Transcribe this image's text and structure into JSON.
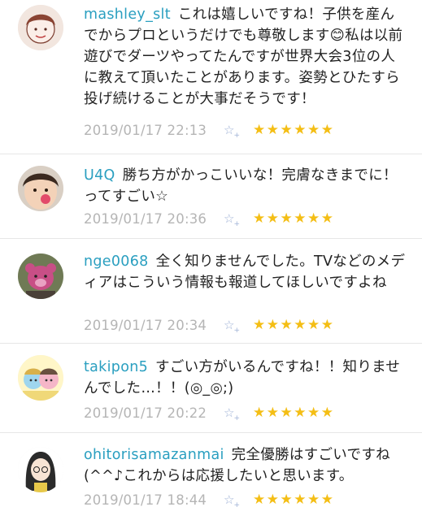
{
  "comments": [
    {
      "user": "mashley_slt",
      "text": "これは嬉しいですね！子供を産んでからプロというだけでも尊敬します😊私は以前遊びでダーツやってたんですが世界大会3位の人に教えて頂いたことがあります。姿勢とひたすら投げ続けることが大事だそうです！",
      "date": "2019/01/17 22:13",
      "stars": "★★★★★★",
      "fav_icon": "☆",
      "fav_plus": "+"
    },
    {
      "user": "U4Q",
      "text": "勝ち方がかっこいいな！完膚なきまでに！ってすごい☆",
      "date": "2019/01/17 20:36",
      "stars": "★★★★★★",
      "fav_icon": "☆",
      "fav_plus": "+"
    },
    {
      "user": "nge0068",
      "text": "全く知りませんでした。TVなどのメディアはこういう情報も報道してほしいですよね",
      "date": "2019/01/17 20:34",
      "stars": "★★★★★★",
      "fav_icon": "☆",
      "fav_plus": "+"
    },
    {
      "user": "takipon5",
      "text": "すごい方がいるんですね！！知りませんでした…！！(◎_◎;)",
      "date": "2019/01/17 20:22",
      "stars": "★★★★★★",
      "fav_icon": "☆",
      "fav_plus": "+"
    },
    {
      "user": "ohitorisamazanmai",
      "text": "完全優勝はすごいですね(^^♪これからは応援したいと思います。",
      "date": "2019/01/17 18:44",
      "stars": "★★★★★★",
      "fav_icon": "☆",
      "fav_plus": "+"
    }
  ]
}
